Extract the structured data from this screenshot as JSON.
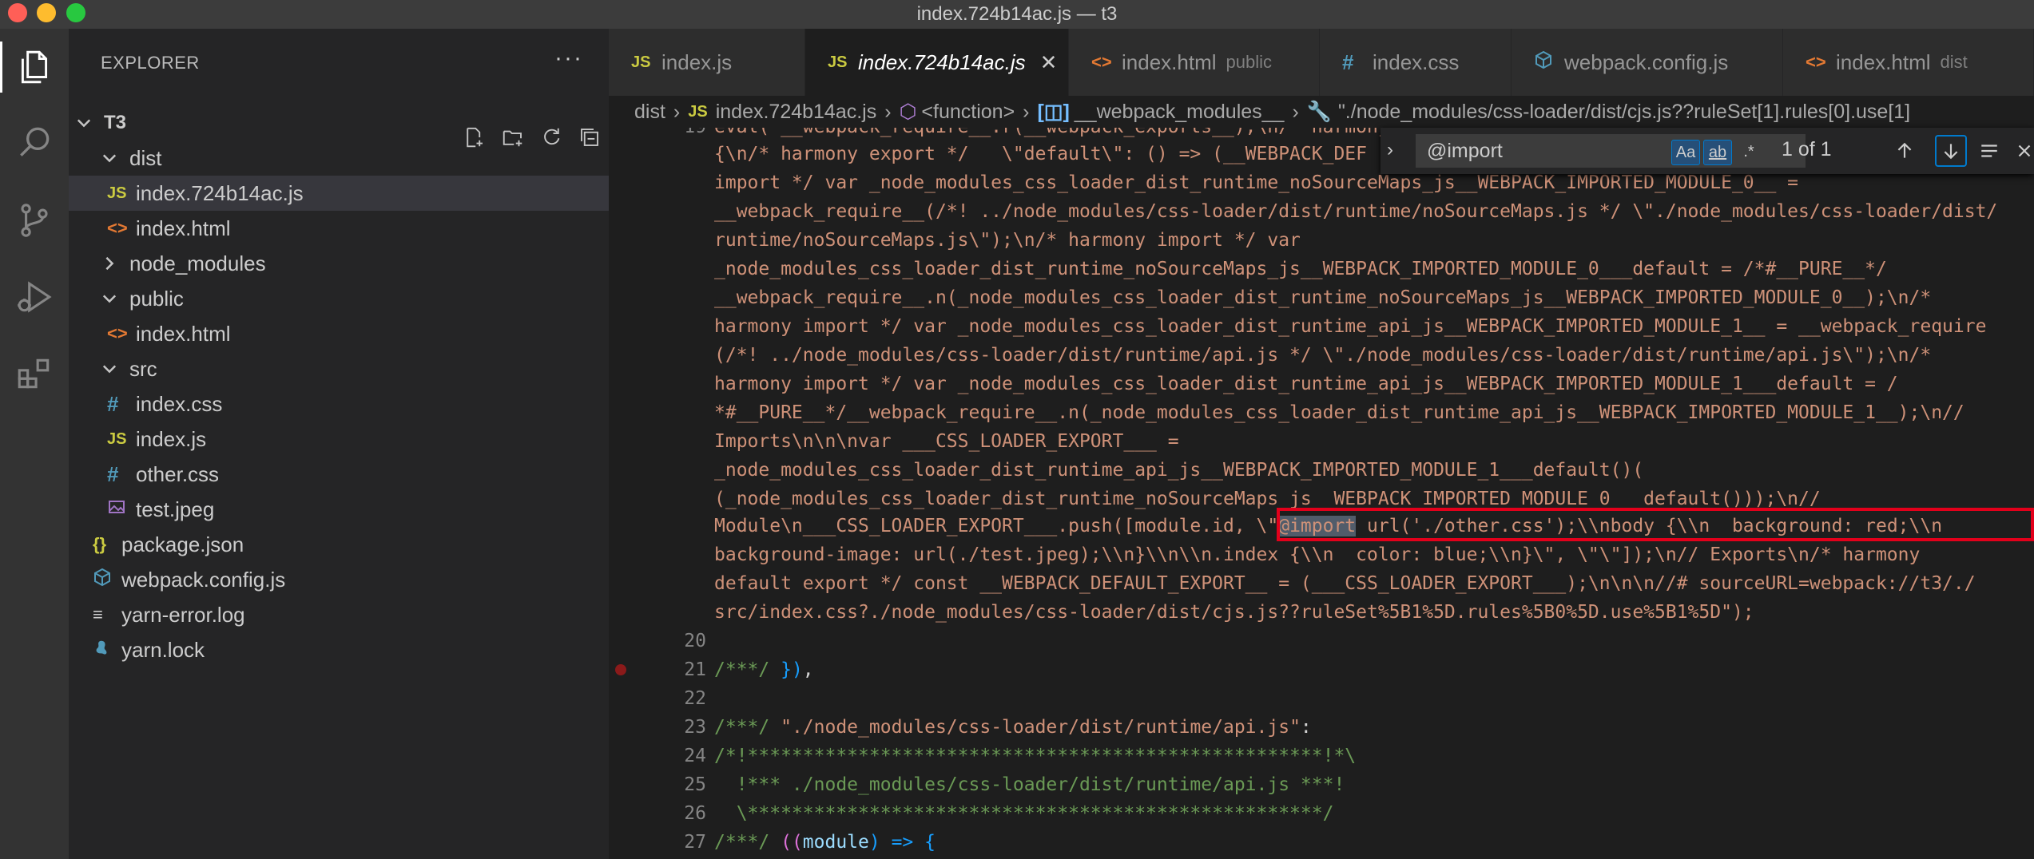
{
  "window": {
    "title": "index.724b14ac.js — t3"
  },
  "explorer": {
    "title": "EXPLORER",
    "more": "···",
    "root": "T3",
    "items": [
      {
        "label": "dist",
        "kind": "folder",
        "open": true
      },
      {
        "label": "index.724b14ac.js",
        "kind": "js",
        "icon": "JS"
      },
      {
        "label": "index.html",
        "kind": "html",
        "icon": "<>"
      },
      {
        "label": "node_modules",
        "kind": "folder",
        "open": false
      },
      {
        "label": "public",
        "kind": "folder",
        "open": true
      },
      {
        "label": "index.html",
        "kind": "html",
        "icon": "<>"
      },
      {
        "label": "src",
        "kind": "folder",
        "open": true
      },
      {
        "label": "index.css",
        "kind": "css",
        "icon": "#"
      },
      {
        "label": "index.js",
        "kind": "js",
        "icon": "JS"
      },
      {
        "label": "other.css",
        "kind": "css",
        "icon": "#"
      },
      {
        "label": "test.jpeg",
        "kind": "image",
        "icon": "image-icon"
      },
      {
        "label": "package.json",
        "kind": "json",
        "icon": "{}"
      },
      {
        "label": "webpack.config.js",
        "kind": "webpack",
        "icon": "webpack-icon"
      },
      {
        "label": "yarn-error.log",
        "kind": "log",
        "icon": "≡"
      },
      {
        "label": "yarn.lock",
        "kind": "yarn",
        "icon": "yarn-icon"
      }
    ]
  },
  "tabs": [
    {
      "label": "index.js",
      "icon": "JS",
      "desc": ""
    },
    {
      "label": "index.724b14ac.js",
      "icon": "JS",
      "desc": "",
      "active": true,
      "close": "✕"
    },
    {
      "label": "index.html",
      "icon": "<>",
      "desc": "public"
    },
    {
      "label": "index.css",
      "icon": "#",
      "desc": ""
    },
    {
      "label": "webpack.config.js",
      "icon": "webpack-icon",
      "desc": ""
    },
    {
      "label": "index.html",
      "icon": "<>",
      "desc": "dist"
    }
  ],
  "breadcrumb": {
    "items": [
      "dist",
      "index.724b14ac.js",
      "<function>",
      "__webpack_modules__",
      "\"./node_modules/css-loader/dist/cjs.js??ruleSet[1].rules[0].use[1]"
    ]
  },
  "find": {
    "query": "@import",
    "match_case": "Aa",
    "whole_word": "ab",
    "regex": ".*",
    "count": "1 of 1"
  },
  "editor": {
    "line_numbers": [
      "19",
      "20",
      "21",
      "22",
      "23",
      "24",
      "25",
      "26",
      "27"
    ],
    "wrapped_lines": [
      "eval(\"__webpack_require__.r(__webpack_exports__);\\n/* harmony",
      "{\\n/* harmony export */   \\\"default\\\": () => (__WEBPACK_DEF",
      "import */ var _node_modules_css_loader_dist_runtime_noSourceMaps_js__WEBPACK_IMPORTED_MODULE_0__ =",
      "__webpack_require__(/*! ../node_modules/css-loader/dist/runtime/noSourceMaps.js */ \\\"./node_modules/css-loader/dist/",
      "runtime/noSourceMaps.js\\\");\\n/* harmony import */ var",
      "_node_modules_css_loader_dist_runtime_noSourceMaps_js__WEBPACK_IMPORTED_MODULE_0___default = /*#__PURE__*/",
      "__webpack_require__.n(_node_modules_css_loader_dist_runtime_noSourceMaps_js__WEBPACK_IMPORTED_MODULE_0__);\\n/*",
      "harmony import */ var _node_modules_css_loader_dist_runtime_api_js__WEBPACK_IMPORTED_MODULE_1__ = __webpack_require",
      "(/*! ../node_modules/css-loader/dist/runtime/api.js */ \\\"./node_modules/css-loader/dist/runtime/api.js\\\");\\n/*",
      "harmony import */ var _node_modules_css_loader_dist_runtime_api_js__WEBPACK_IMPORTED_MODULE_1___default = /",
      "*#__PURE__*/__webpack_require__.n(_node_modules_css_loader_dist_runtime_api_js__WEBPACK_IMPORTED_MODULE_1__);\\n//",
      "Imports\\n\\n\\nvar ___CSS_LOADER_EXPORT___ =",
      "_node_modules_css_loader_dist_runtime_api_js__WEBPACK_IMPORTED_MODULE_1___default()(",
      "(_node_modules_css_loader_dist_runtime_noSourceMaps_js__WEBPACK_IMPORTED_MODULE_0___default()));\\n//",
      "Module\\n___CSS_LOADER_EXPORT___.push([module.id, ",
      "background-image: url(./test.jpeg);\\\\n}\\\\n\\\\n.index {\\\\n  color: blue;\\\\n}\\\", \\\"\\\"]);\\n// Exports\\n/* harmony",
      "default export */ const __WEBPACK_DEFAULT_EXPORT__ = (___CSS_LOADER_EXPORT___);\\n\\n\\n//# sourceURL=webpack://t3/./",
      "src/index.css?./node_modules/css-loader/dist/cjs.js??ruleSet%5B1%5D.rules%5B0%5D.use%5B1%5D\");"
    ],
    "highlight_prefix": "\\\"",
    "highlight_match": "@import",
    "highlight_suffix": " url('./other.css');\\\\nbody {\\\\n  background: red;\\\\n",
    "line20": "",
    "line21_a": "/***/ ",
    "line21_b": "})",
    "line21_c": ",",
    "line23_a": "/***/ ",
    "line23_b": "\"./node_modules/css-loader/dist/runtime/api.js\"",
    "line23_c": ":",
    "line24": "/*!****************************************************!*\\",
    "line25": "  !*** ./node_modules/css-loader/dist/runtime/api.js ***!",
    "line26": "  \\****************************************************/",
    "line27_a": "/***/ ",
    "line27_b": "((",
    "line27_c": "module",
    "line27_d": ") => ",
    "line27_e": "{"
  }
}
